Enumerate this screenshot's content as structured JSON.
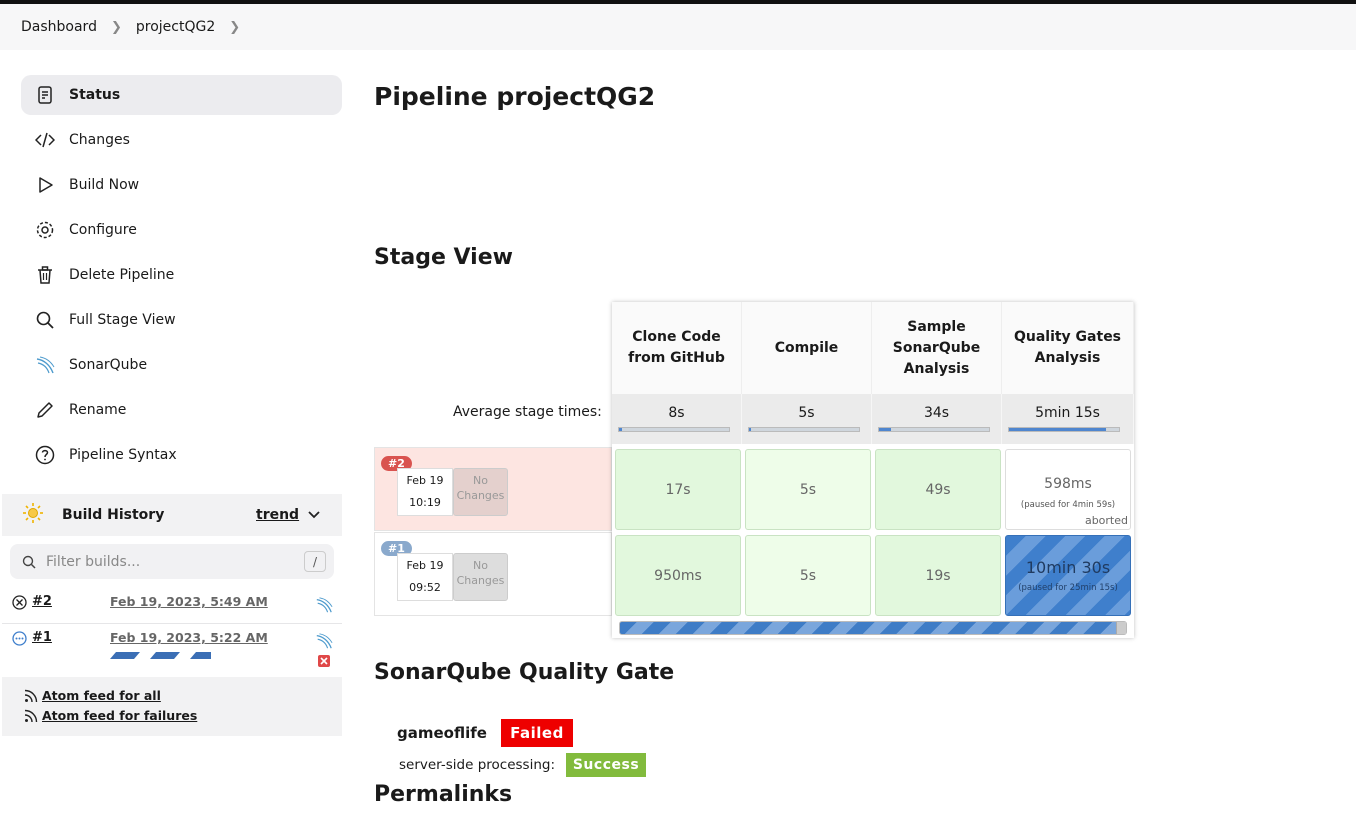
{
  "breadcrumb": {
    "items": [
      "Dashboard",
      "projectQG2"
    ]
  },
  "sidebar": {
    "items": [
      {
        "label": "Status",
        "icon": "document-icon"
      },
      {
        "label": "Changes",
        "icon": "code-icon"
      },
      {
        "label": "Build Now",
        "icon": "play-icon"
      },
      {
        "label": "Configure",
        "icon": "gear-icon"
      },
      {
        "label": "Delete Pipeline",
        "icon": "trash-icon"
      },
      {
        "label": "Full Stage View",
        "icon": "search-icon"
      },
      {
        "label": "SonarQube",
        "icon": "sonarqube-icon"
      },
      {
        "label": "Rename",
        "icon": "pencil-icon"
      },
      {
        "label": "Pipeline Syntax",
        "icon": "help-icon"
      }
    ]
  },
  "build_history": {
    "title": "Build History",
    "trend": "trend",
    "filter_placeholder": "Filter builds...",
    "filter_shortcut": "/",
    "builds": [
      {
        "number": "#2",
        "date": "Feb 19, 2023, 5:49 AM",
        "status": "aborted"
      },
      {
        "number": "#1",
        "date": "Feb 19, 2023, 5:22 AM",
        "status": "running"
      }
    ],
    "feeds": [
      "Atom feed for all",
      "Atom feed for failures"
    ]
  },
  "main": {
    "title": "Pipeline projectQG2",
    "stage_view_title": "Stage View",
    "average_label": "Average stage times:",
    "stages": [
      {
        "name": "Clone Code from GitHub",
        "avg": "8s",
        "avg_fraction": 0.03
      },
      {
        "name": "Compile",
        "avg": "5s",
        "avg_fraction": 0.02
      },
      {
        "name": "Sample SonarQube Analysis",
        "avg": "34s",
        "avg_fraction": 0.11
      },
      {
        "name": "Quality Gates Analysis",
        "avg": "5min 15s",
        "avg_fraction": 0.88
      }
    ],
    "runs": [
      {
        "badge": "#2",
        "date": "Feb 19",
        "time": "10:19",
        "changes": "No Changes",
        "cells": [
          {
            "value": "17s"
          },
          {
            "value": "5s"
          },
          {
            "value": "49s"
          },
          {
            "value": "598ms",
            "paused": "(paused for 4min 59s)",
            "note": "aborted"
          }
        ]
      },
      {
        "badge": "#1",
        "date": "Feb 19",
        "time": "09:52",
        "changes": "No Changes",
        "cells": [
          {
            "value": "950ms"
          },
          {
            "value": "5s"
          },
          {
            "value": "19s"
          },
          {
            "value": "10min 30s",
            "paused": "(paused for 25min 15s)"
          }
        ]
      }
    ],
    "quality_gate_title": "SonarQube Quality Gate",
    "quality_gate": {
      "project": "gameoflife",
      "status": "Failed",
      "processing_label": "server-side processing:",
      "processing_status": "Success"
    },
    "permalinks_title": "Permalinks"
  },
  "colors": {
    "failed": "#ee0000",
    "success": "#82bb3d",
    "accent": "#4f86cf"
  }
}
